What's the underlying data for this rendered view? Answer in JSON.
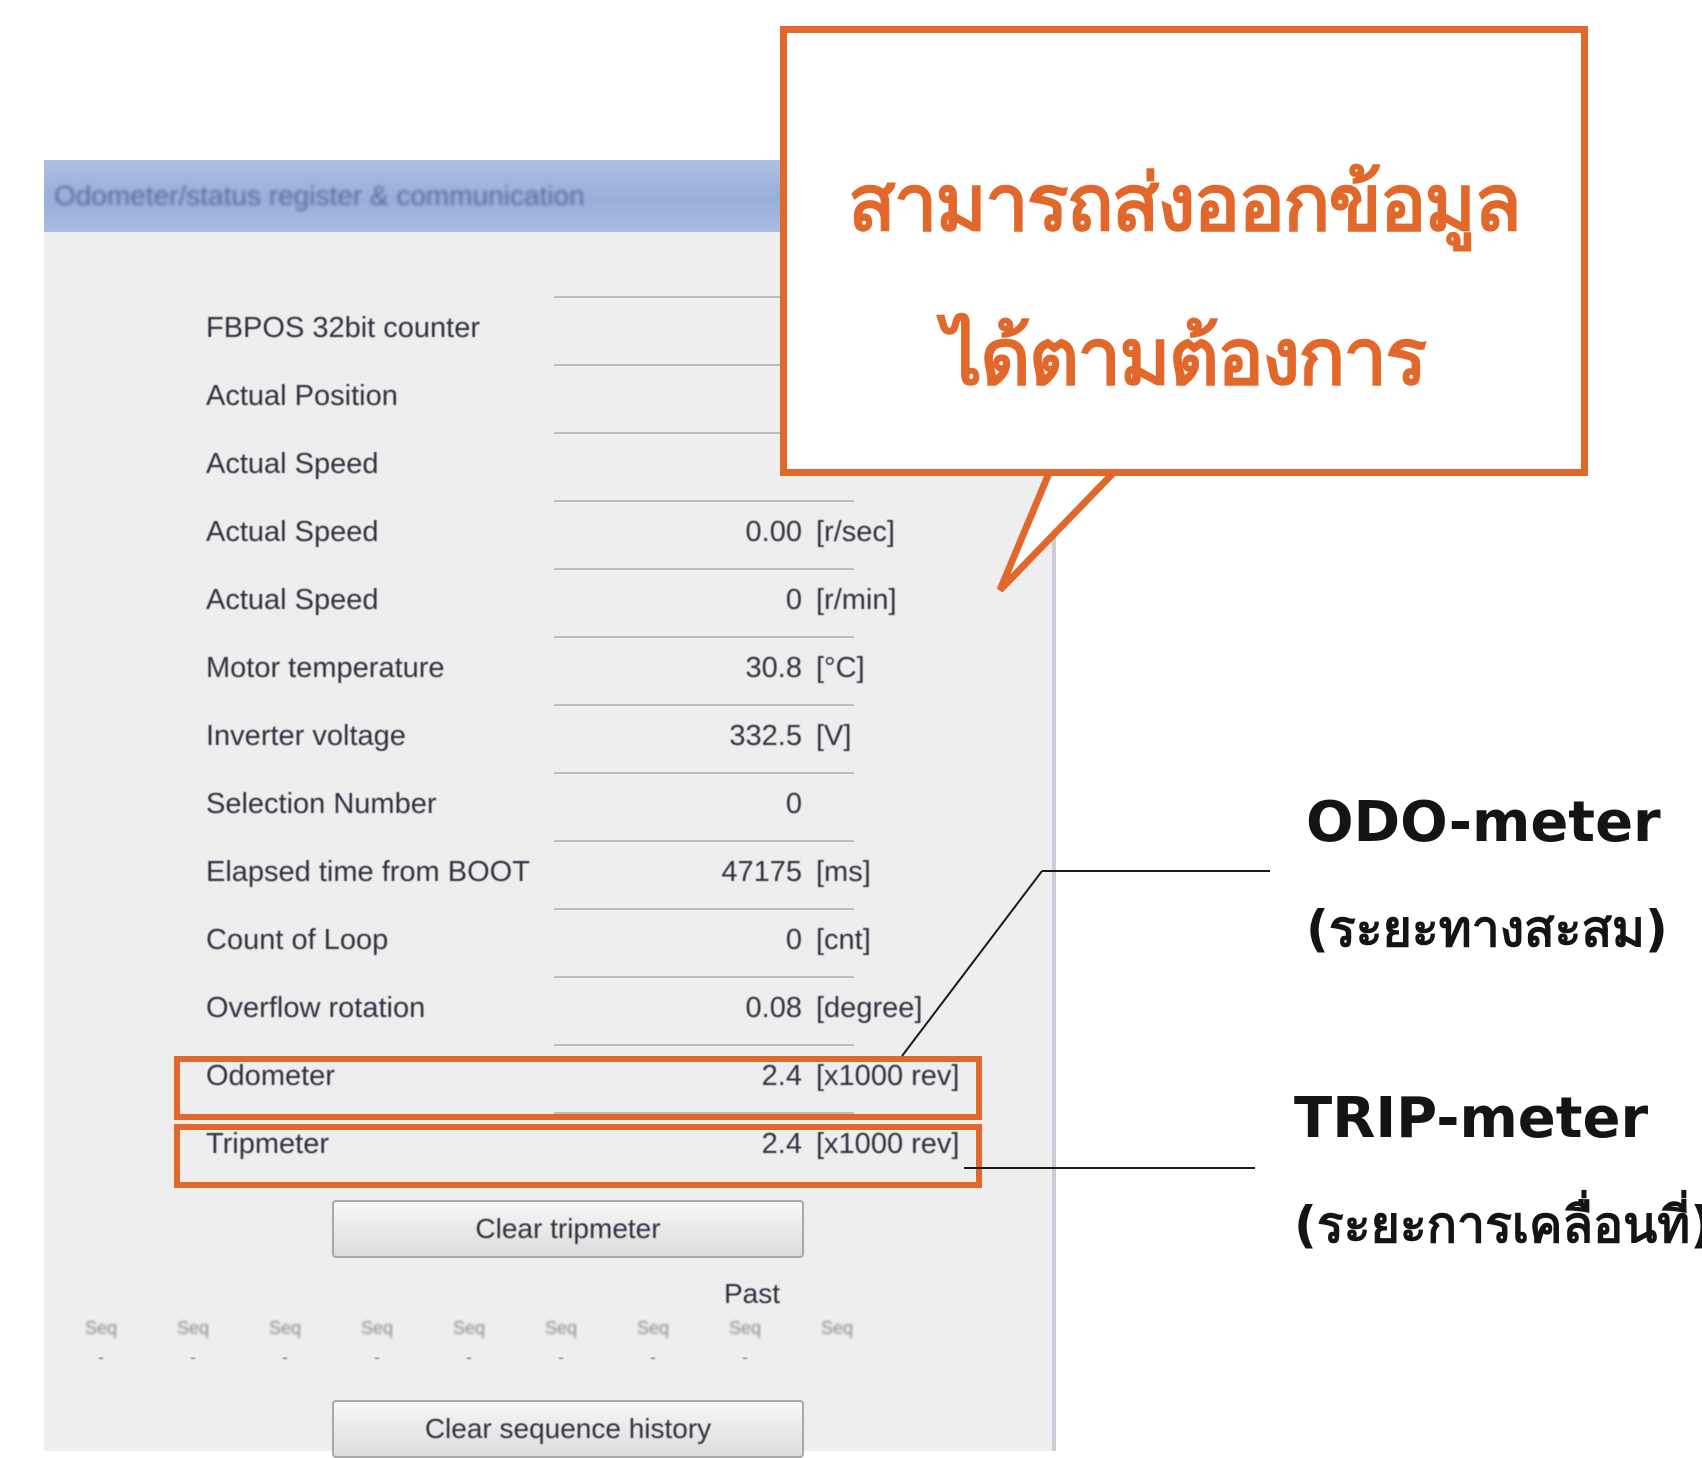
{
  "window": {
    "title": "Odometer/status register & communication",
    "rows": [
      {
        "label": "FBPOS 32bit counter",
        "value": "",
        "unit": ""
      },
      {
        "label": "Actual Position",
        "value": "",
        "unit": ""
      },
      {
        "label": "Actual Speed",
        "value": "",
        "unit": ""
      },
      {
        "label": "Actual Speed",
        "value": "0.00",
        "unit": "[r/sec]"
      },
      {
        "label": "Actual Speed",
        "value": "0",
        "unit": "[r/min]"
      },
      {
        "label": "Motor temperature",
        "value": "30.8",
        "unit": "[°C]"
      },
      {
        "label": "Inverter voltage",
        "value": "332.5",
        "unit": "[V]"
      },
      {
        "label": "Selection Number",
        "value": "0",
        "unit": ""
      },
      {
        "label": "Elapsed time from BOOT",
        "value": "47175",
        "unit": "[ms]"
      },
      {
        "label": "Count of Loop",
        "value": "0",
        "unit": "[cnt]"
      },
      {
        "label": "Overflow rotation",
        "value": "0.08",
        "unit": "[degree]"
      },
      {
        "label": "Odometer",
        "value": "2.4",
        "unit": "[x1000 rev]"
      },
      {
        "label": "Tripmeter",
        "value": "2.4",
        "unit": "[x1000 rev]"
      }
    ],
    "clear_tripmeter_label": "Clear tripmeter",
    "past_label": "Past",
    "sequence_headers": [
      "Seq",
      "Seq",
      "Seq",
      "Seq",
      "Seq",
      "Seq",
      "Seq",
      "Seq",
      "Seq"
    ],
    "sequence_values": [
      "-",
      "-",
      "-",
      "-",
      "-",
      "-",
      "-",
      "-"
    ],
    "clear_sequence_history_label": "Clear sequence history"
  },
  "callout": {
    "line1": "สามารถส่งออกข้อมูล",
    "line2": "ได้ตามต้องการ",
    "border_color": "#e2672a"
  },
  "annotations": {
    "odo_title": "ODO-meter",
    "odo_subtitle": "(ระยะทางสะสม)",
    "trip_title": "TRIP-meter",
    "trip_subtitle": "(ระยะการเคลื่อนที่)"
  }
}
